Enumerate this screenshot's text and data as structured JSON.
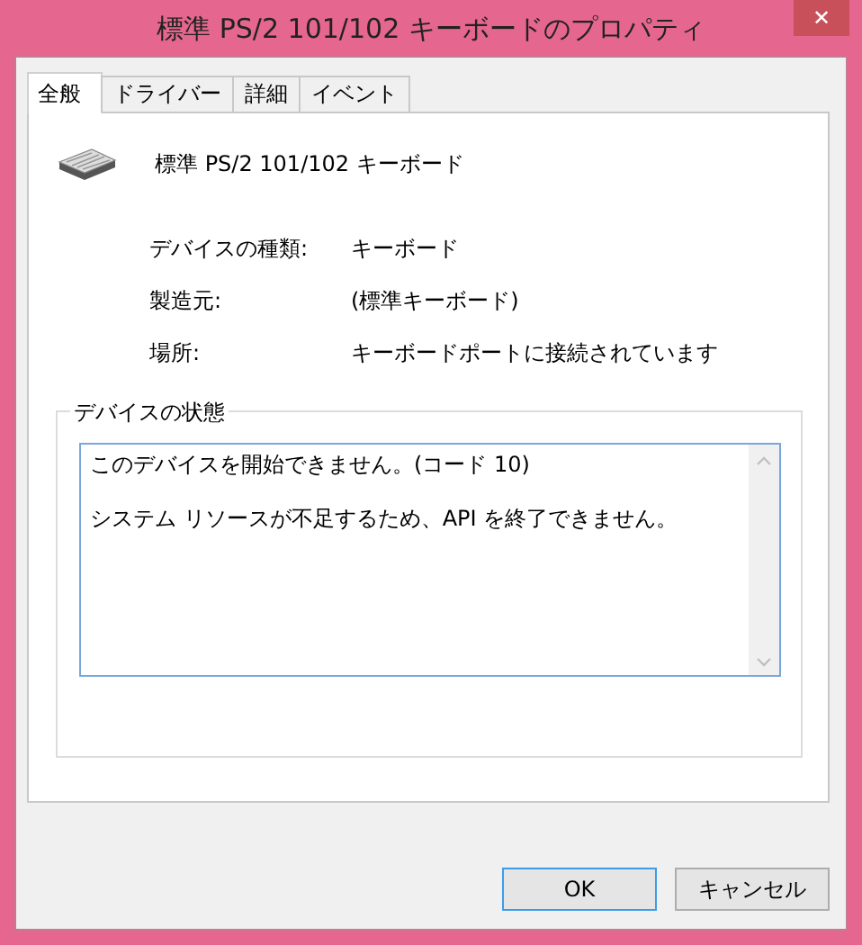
{
  "window": {
    "title": "標準 PS/2 101/102 キーボードのプロパティ",
    "close": "✕"
  },
  "tabs": [
    {
      "label": "全般",
      "selected": true
    },
    {
      "label": "ドライバー",
      "selected": false
    },
    {
      "label": "詳細",
      "selected": false
    },
    {
      "label": "イベント",
      "selected": false
    }
  ],
  "device_name": "標準 PS/2 101/102 キーボード",
  "properties": [
    {
      "label": "デバイスの種類:",
      "value": "キーボード"
    },
    {
      "label": "製造元:",
      "value": "(標準キーボード)"
    },
    {
      "label": "場所:",
      "value": "キーボードポートに接続されています"
    }
  ],
  "status_group": {
    "title": "デバイスの状態",
    "lines": [
      "このデバイスを開始できません。(コード 10)",
      "システム リソースが不足するため、API を終了できません。"
    ]
  },
  "buttons": [
    {
      "label": "OK",
      "default": true
    },
    {
      "label": "キャンセル",
      "default": false
    }
  ]
}
